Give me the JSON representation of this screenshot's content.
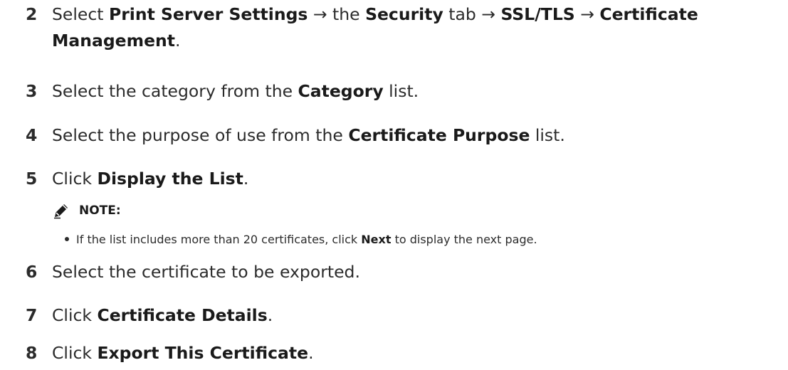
{
  "steps": [
    {
      "num": "2",
      "segments": [
        {
          "t": "Select ",
          "b": false
        },
        {
          "t": "Print Server Settings",
          "b": true
        },
        {
          "t": " → the ",
          "b": false
        },
        {
          "t": "Security",
          "b": true
        },
        {
          "t": " tab → ",
          "b": false
        },
        {
          "t": "SSL/TLS",
          "b": true
        },
        {
          "t": " → ",
          "b": false
        },
        {
          "t": "Certificate",
          "b": true
        }
      ],
      "cont": [
        {
          "t": "Management",
          "b": true
        },
        {
          "t": ".",
          "b": false
        }
      ]
    },
    {
      "num": "3",
      "segments": [
        {
          "t": "Select the category from the ",
          "b": false
        },
        {
          "t": "Category",
          "b": true
        },
        {
          "t": " list.",
          "b": false
        }
      ]
    },
    {
      "num": "4",
      "segments": [
        {
          "t": "Select the purpose of use from the ",
          "b": false
        },
        {
          "t": "Certificate Purpose",
          "b": true
        },
        {
          "t": " list.",
          "b": false
        }
      ]
    },
    {
      "num": "5",
      "segments": [
        {
          "t": "Click ",
          "b": false
        },
        {
          "t": "Display the List",
          "b": true
        },
        {
          "t": ".",
          "b": false
        }
      ]
    },
    {
      "num": "6",
      "segments": [
        {
          "t": "Select the certificate to be exported.",
          "b": false
        }
      ]
    },
    {
      "num": "7",
      "segments": [
        {
          "t": "Click ",
          "b": false
        },
        {
          "t": "Certificate Details",
          "b": true
        },
        {
          "t": ".",
          "b": false
        }
      ]
    },
    {
      "num": "8",
      "segments": [
        {
          "t": "Click ",
          "b": false
        },
        {
          "t": "Export This Certificate",
          "b": true
        },
        {
          "t": ".",
          "b": false
        }
      ]
    }
  ],
  "note": {
    "icon": "pencil-note-icon",
    "heading": "NOTE:",
    "bullet": [
      {
        "t": "If the list includes more than 20 certificates, click ",
        "b": false
      },
      {
        "t": "Next",
        "b": true
      },
      {
        "t": " to display the next page.",
        "b": false
      }
    ]
  }
}
